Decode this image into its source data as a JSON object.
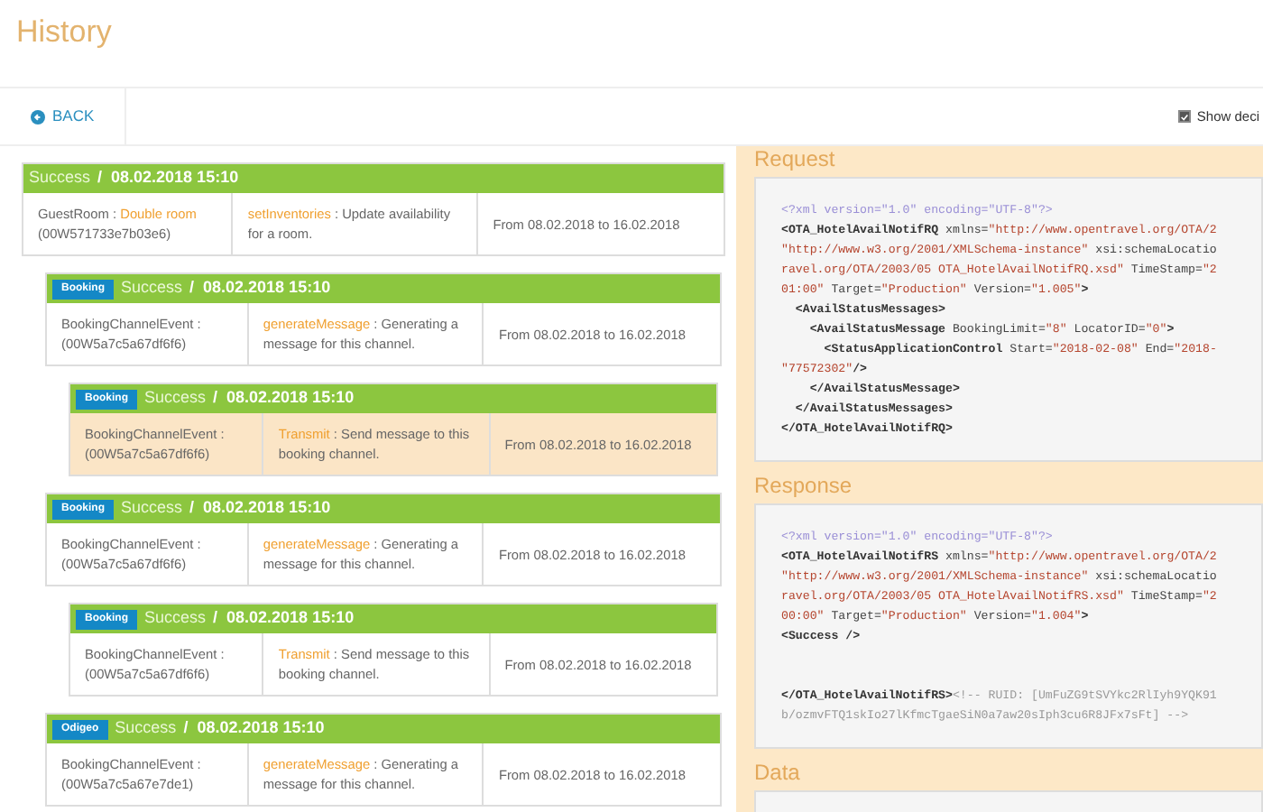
{
  "page_title": "History",
  "toolbar": {
    "back_label": "BACK",
    "show_decisions": {
      "label": "Show deci",
      "checked": true
    }
  },
  "entries": [
    {
      "status": "Success",
      "date": "/  08.02.2018 15:10",
      "selected": false,
      "object": {
        "label": "GuestRoom :",
        "value": "Double room",
        "id": "(00W571733e7b03e6)"
      },
      "method": {
        "name": "setInventories",
        "description": ": Update availability for a room."
      },
      "range": "From 08.02.2018 to 16.02.2018",
      "children": [
        {
          "badge": "Booking",
          "status": "Success",
          "date": "/  08.02.2018 15:10",
          "selected": false,
          "object": {
            "label": "BookingChannelEvent :",
            "id": "(00W5a7c5a67df6f6)"
          },
          "method": {
            "name": "generateMessage",
            "description": ": Generating a message for this channel."
          },
          "range": "From 08.02.2018 to 16.02.2018",
          "children": [
            {
              "badge": "Booking",
              "status": "Success",
              "date": "/  08.02.2018 15:10",
              "selected": true,
              "object": {
                "label": "BookingChannelEvent :",
                "id": "(00W5a7c5a67df6f6)"
              },
              "method": {
                "name": "Transmit",
                "description": ": Send message to this booking channel."
              },
              "range": "From 08.02.2018 to 16.02.2018"
            }
          ]
        },
        {
          "badge": "Booking",
          "status": "Success",
          "date": "/  08.02.2018 15:10",
          "selected": false,
          "object": {
            "label": "BookingChannelEvent :",
            "id": "(00W5a7c5a67df6f6)"
          },
          "method": {
            "name": "generateMessage",
            "description": ": Generating a message for this channel."
          },
          "range": "From 08.02.2018 to 16.02.2018",
          "children": [
            {
              "badge": "Booking",
              "status": "Success",
              "date": "/  08.02.2018 15:10",
              "selected": false,
              "object": {
                "label": "BookingChannelEvent :",
                "id": "(00W5a7c5a67df6f6)"
              },
              "method": {
                "name": "Transmit",
                "description": ": Send message to this booking channel."
              },
              "range": "From 08.02.2018 to 16.02.2018"
            }
          ]
        },
        {
          "badge": "Odigeo",
          "status": "Success",
          "date": "/  08.02.2018 15:10",
          "selected": false,
          "object": {
            "label": "BookingChannelEvent :",
            "id": "(00W5a7c5a67e7de1)"
          },
          "method": {
            "name": "generateMessage",
            "description": ": Generating a message for this channel."
          },
          "range": "From 08.02.2018 to 16.02.2018"
        }
      ]
    }
  ],
  "detail": {
    "sections": [
      {
        "title": "Request",
        "lines": [
          [
            {
              "kind": "decl",
              "text": "<?xml version=\"1.0\" encoding=\"UTF-8\"?>"
            }
          ],
          [
            {
              "kind": "tag",
              "text": "<OTA_HotelAvailNotifRQ"
            },
            {
              "kind": "attr",
              "text": " xmlns="
            },
            {
              "kind": "value",
              "text": "\"http://www.opentravel.org/OTA/2"
            }
          ],
          [
            {
              "kind": "value",
              "text": "\"http://www.w3.org/2001/XMLSchema-instance\""
            },
            {
              "kind": "attr",
              "text": " xsi:schemaLocatio"
            }
          ],
          [
            {
              "kind": "value",
              "text": "ravel.org/OTA/2003/05 OTA_HotelAvailNotifRQ.xsd\""
            },
            {
              "kind": "attr",
              "text": " TimeStamp="
            },
            {
              "kind": "value",
              "text": "\"2"
            }
          ],
          [
            {
              "kind": "value",
              "text": "01:00\""
            },
            {
              "kind": "attr",
              "text": " Target="
            },
            {
              "kind": "value",
              "text": "\"Production\""
            },
            {
              "kind": "attr",
              "text": " Version="
            },
            {
              "kind": "value",
              "text": "\"1.005\""
            },
            {
              "kind": "tag",
              "text": ">"
            }
          ],
          [
            {
              "kind": "tag",
              "text": "  <AvailStatusMessages>"
            }
          ],
          [
            {
              "kind": "tag",
              "text": "    <AvailStatusMessage"
            },
            {
              "kind": "attr",
              "text": " BookingLimit="
            },
            {
              "kind": "value",
              "text": "\"8\""
            },
            {
              "kind": "attr",
              "text": " LocatorID="
            },
            {
              "kind": "value",
              "text": "\"0\""
            },
            {
              "kind": "tag",
              "text": ">"
            }
          ],
          [
            {
              "kind": "tag",
              "text": "      <StatusApplicationControl"
            },
            {
              "kind": "attr",
              "text": " Start="
            },
            {
              "kind": "value",
              "text": "\"2018-02-08\""
            },
            {
              "kind": "attr",
              "text": " End="
            },
            {
              "kind": "value",
              "text": "\"2018-"
            }
          ],
          [
            {
              "kind": "value",
              "text": "\"77572302\""
            },
            {
              "kind": "tag",
              "text": "/>"
            }
          ],
          [
            {
              "kind": "tag",
              "text": "    </AvailStatusMessage>"
            }
          ],
          [
            {
              "kind": "tag",
              "text": "  </AvailStatusMessages>"
            }
          ],
          [
            {
              "kind": "tag",
              "text": "</OTA_HotelAvailNotifRQ>"
            }
          ]
        ]
      },
      {
        "title": "Response",
        "lines": [
          [
            {
              "kind": "decl",
              "text": "<?xml version=\"1.0\" encoding=\"UTF-8\"?>"
            }
          ],
          [
            {
              "kind": "tag",
              "text": "<OTA_HotelAvailNotifRS"
            },
            {
              "kind": "attr",
              "text": " xmlns="
            },
            {
              "kind": "value",
              "text": "\"http://www.opentravel.org/OTA/2"
            }
          ],
          [
            {
              "kind": "value",
              "text": "\"http://www.w3.org/2001/XMLSchema-instance\""
            },
            {
              "kind": "attr",
              "text": " xsi:schemaLocatio"
            }
          ],
          [
            {
              "kind": "value",
              "text": "ravel.org/OTA/2003/05 OTA_HotelAvailNotifRS.xsd\""
            },
            {
              "kind": "attr",
              "text": " TimeStamp="
            },
            {
              "kind": "value",
              "text": "\"2"
            }
          ],
          [
            {
              "kind": "value",
              "text": "00:00\""
            },
            {
              "kind": "attr",
              "text": " Target="
            },
            {
              "kind": "value",
              "text": "\"Production\""
            },
            {
              "kind": "attr",
              "text": " Version="
            },
            {
              "kind": "value",
              "text": "\"1.004\""
            },
            {
              "kind": "tag",
              "text": ">"
            }
          ],
          [
            {
              "kind": "tag",
              "text": "<Success />"
            }
          ],
          [
            {
              "kind": "gap"
            }
          ],
          [
            {
              "kind": "gap"
            }
          ],
          [
            {
              "kind": "tag",
              "text": "</OTA_HotelAvailNotifRS>"
            },
            {
              "kind": "comment",
              "text": "<!-- RUID: [UmFuZG9tSVYkc2RlIyh9YQK91"
            }
          ],
          [
            {
              "kind": "comment",
              "text": "b/ozmvFTQ1skIo27lKfmcTgaeSiN0a7aw20sIph3cu6R8JFx7sFt] -->"
            }
          ]
        ]
      },
      {
        "title": "Data"
      }
    ]
  }
}
